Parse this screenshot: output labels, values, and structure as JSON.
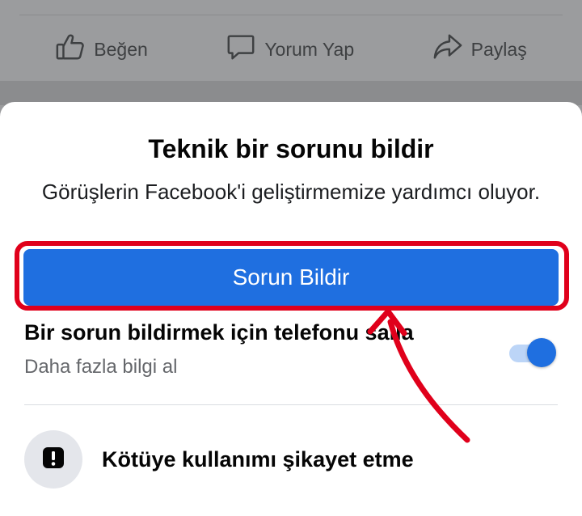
{
  "post_actions": {
    "like_label": "Beğen",
    "comment_label": "Yorum Yap",
    "share_label": "Paylaş"
  },
  "sheet": {
    "title": "Teknik bir sorunu bildir",
    "subtitle": "Görüşlerin Facebook'i geliştirmemize yardımcı oluyor.",
    "report_button_label": "Sorun Bildir",
    "shake": {
      "title": "Bir sorun bildirmek için telefonu salla",
      "subtitle": "Daha fazla bilgi al",
      "enabled": true
    },
    "abuse": {
      "label": "Kötüye kullanımı şikayet etme",
      "icon": "exclamation-icon"
    }
  },
  "annotation": {
    "highlight_color": "#e0001b"
  },
  "colors": {
    "primary": "#1f6fe0",
    "toggle_track": "#bcd5f7"
  }
}
